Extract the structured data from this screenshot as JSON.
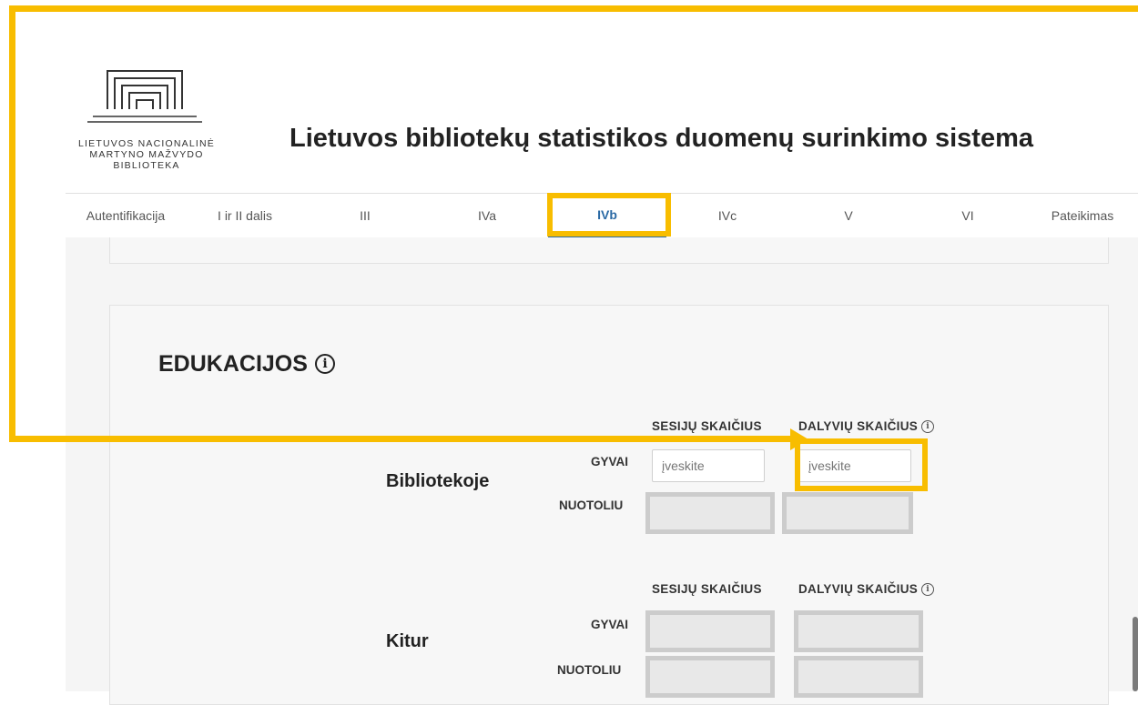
{
  "logo": {
    "line1": "LIETUVOS NACIONALINĖ",
    "line2": "MARTYNO MAŽVYDO",
    "line3": "BIBLIOTEKA"
  },
  "site_title": "Lietuvos bibliotekų statistikos duomenų surinkimo sistema",
  "nav": {
    "tabs": [
      {
        "label": "Autentifikacija"
      },
      {
        "label": "I ir II dalis"
      },
      {
        "label": "III"
      },
      {
        "label": "IVa"
      },
      {
        "label": "IVb",
        "active": true
      },
      {
        "label": "IVc"
      },
      {
        "label": "V"
      },
      {
        "label": "VI"
      },
      {
        "label": "Pateikimas"
      }
    ]
  },
  "section": {
    "title": "EDUKACIJOS",
    "info_symbol": "i"
  },
  "columns": {
    "sessions": "SESIJŲ SKAIČIUS",
    "participants": "DALYVIŲ SKAIČIUS",
    "info_symbol": "i"
  },
  "groups": [
    {
      "label": "Bibliotekoje",
      "rows": [
        {
          "label": "GYVAI",
          "sessions_placeholder": "įveskite",
          "participants_placeholder": "įveskite"
        },
        {
          "label": "NUOTOLIU"
        }
      ]
    },
    {
      "label": "Kitur",
      "rows": [
        {
          "label": "GYVAI"
        },
        {
          "label": "NUOTOLIU"
        }
      ]
    }
  ],
  "colors": {
    "highlight": "#f8bd00",
    "active_tab": "#2b6aa5",
    "disabled_field": "#e8e8e8"
  }
}
